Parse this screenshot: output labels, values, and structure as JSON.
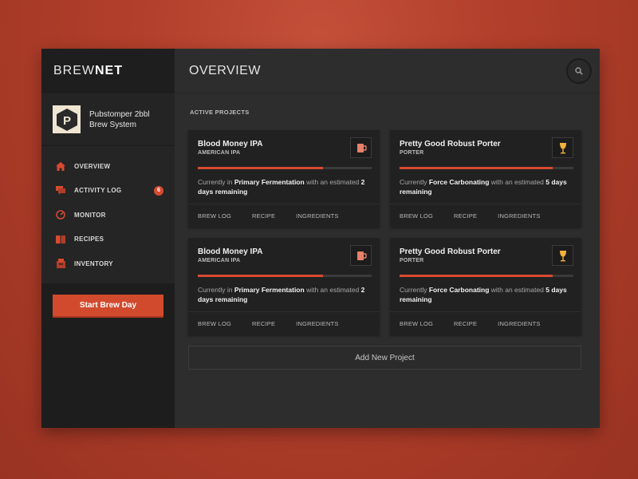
{
  "brand": {
    "part1": "BREW",
    "part2": "NET"
  },
  "profile": {
    "name_line1": "Pubstomper 2bbl",
    "name_line2": "Brew System",
    "logo_letter": "P"
  },
  "nav": [
    {
      "label": "OVERVIEW",
      "icon": "home-icon"
    },
    {
      "label": "ACTIVITY LOG",
      "icon": "chat-icon",
      "badge": "6"
    },
    {
      "label": "MONITOR",
      "icon": "gauge-icon"
    },
    {
      "label": "RECIPES",
      "icon": "book-icon"
    },
    {
      "label": "INVENTORY",
      "icon": "box-icon"
    }
  ],
  "start_button": "Start Brew Day",
  "header": {
    "title": "OVERVIEW",
    "search_icon": "search-icon"
  },
  "section_label": "ACTIVE PROJECTS",
  "projects": [
    {
      "title": "Blood Money IPA",
      "style": "AMERICAN IPA",
      "icon": "mug-icon",
      "icon_color": "#e8806a",
      "progress": 0.72,
      "status_prefix": "Currently in ",
      "status_stage": "Primary Fermentation",
      "status_mid": " with an estimated ",
      "status_remaining": "2 days remaining",
      "links": [
        "BREW LOG",
        "RECIPE",
        "INGREDIENTS"
      ]
    },
    {
      "title": "Pretty Good Robust Porter",
      "style": "PORTER",
      "icon": "tulip-glass-icon",
      "icon_color": "#f0b23c",
      "progress": 0.88,
      "status_prefix": "Currently ",
      "status_stage": "Force Carbonating",
      "status_mid": " with an estimated ",
      "status_remaining": "5 days remaining",
      "links": [
        "BREW LOG",
        "RECIPE",
        "INGREDIENTS"
      ]
    },
    {
      "title": "Blood Money IPA",
      "style": "AMERICAN IPA",
      "icon": "mug-icon",
      "icon_color": "#e8806a",
      "progress": 0.72,
      "status_prefix": "Currently in ",
      "status_stage": "Primary Fermentation",
      "status_mid": " with an estimated ",
      "status_remaining": "2 days remaining",
      "links": [
        "BREW LOG",
        "RECIPE",
        "INGREDIENTS"
      ]
    },
    {
      "title": "Pretty Good Robust Porter",
      "style": "PORTER",
      "icon": "tulip-glass-icon",
      "icon_color": "#f0b23c",
      "progress": 0.88,
      "status_prefix": "Currently ",
      "status_stage": "Force Carbonating",
      "status_mid": " with an estimated ",
      "status_remaining": "5 days remaining",
      "links": [
        "BREW LOG",
        "RECIPE",
        "INGREDIENTS"
      ]
    }
  ],
  "add_project": "Add New Project",
  "colors": {
    "accent": "#d84a30",
    "background": "#b23f2b",
    "panel": "#2d2d2d",
    "sidebar": "#222222"
  }
}
